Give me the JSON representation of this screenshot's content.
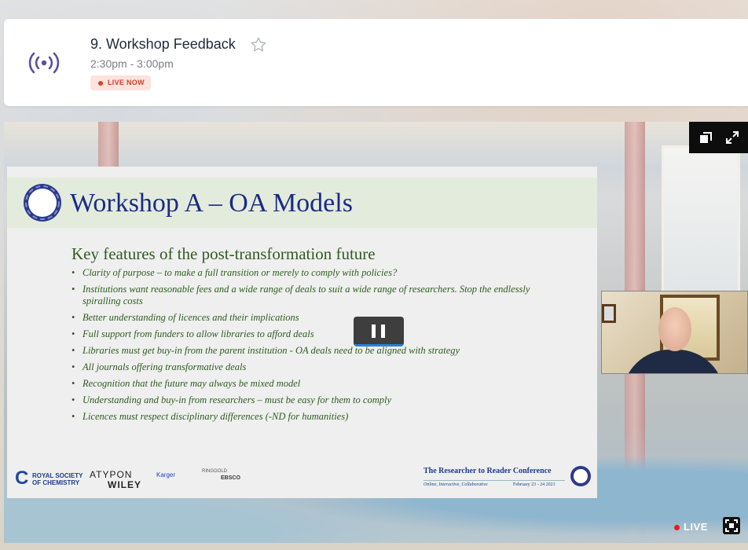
{
  "session": {
    "title": "9. Workshop Feedback",
    "time": "2:30pm - 3:00pm",
    "live_badge": "LIVE NOW"
  },
  "icons": {
    "broadcast": "broadcast-icon",
    "favorite": "star-icon",
    "popout": "popout-icon",
    "expand": "expand-icon",
    "pause": "pause-icon",
    "fullscreen": "fullscreen-icon"
  },
  "colors": {
    "accent": "#5a4ea0",
    "live_red": "#e0401f",
    "slide_green": "#2c5d1e",
    "slide_blue": "#1c2a86"
  },
  "slide": {
    "logo_text": "Researcher to Reader",
    "title": "Workshop A – OA Models",
    "subtitle": "Key features of the post-transformation future",
    "bullets": [
      "Clarity of purpose – to make a full transition or merely to comply with policies?",
      "Institutions want reasonable fees and a wide range of deals to suit a wide range of researchers. Stop the endlessly spiralling costs",
      "Better understanding of licences and their implications",
      "Full support from funders to allow libraries to afford deals",
      "Libraries must get buy-in from the parent institution - OA deals need to be aligned with strategy",
      "All journals offering transformative deals",
      "Recognition that the future may always be mixed model",
      "Understanding and buy-in from researchers – must be easy for them to comply",
      "Licences must respect disciplinary differences (-ND for humanities)"
    ],
    "sponsors": {
      "rsc_line1": "ROYAL SOCIETY",
      "rsc_line2": "OF CHEMISTRY",
      "atypon": "ATYPON",
      "wiley": "WILEY",
      "karger": "Karger",
      "ringgold": "RINGGOLD",
      "ebsco": "EBSCO"
    },
    "conference": {
      "name": "The Researcher to Reader Conference",
      "tagline": "Online, Interactive, Collaborative",
      "dates": "February 23 - 24 2021"
    }
  },
  "player": {
    "live_label": "LIVE"
  }
}
